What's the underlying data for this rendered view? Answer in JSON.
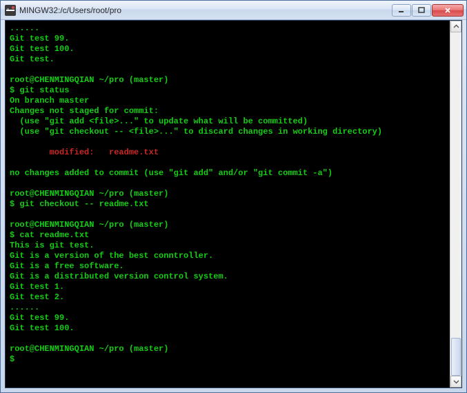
{
  "window": {
    "title": "MINGW32:/c/Users/root/pro"
  },
  "terminal": {
    "lines": [
      {
        "text": "......"
      },
      {
        "text": "Git test 99."
      },
      {
        "text": "Git test 100."
      },
      {
        "text": "Git test."
      },
      {
        "text": ""
      },
      {
        "text": "root@CHENMINGQIAN ~/pro (master)",
        "class": "prompt"
      },
      {
        "text": "$ git status"
      },
      {
        "text": "On branch master"
      },
      {
        "text": "Changes not staged for commit:"
      },
      {
        "text": "  (use \"git add <file>...\" to update what will be committed)"
      },
      {
        "text": "  (use \"git checkout -- <file>...\" to discard changes in working directory)"
      },
      {
        "text": ""
      },
      {
        "text": "        modified:   readme.txt",
        "class": "red"
      },
      {
        "text": ""
      },
      {
        "text": "no changes added to commit (use \"git add\" and/or \"git commit -a\")"
      },
      {
        "text": ""
      },
      {
        "text": "root@CHENMINGQIAN ~/pro (master)",
        "class": "prompt"
      },
      {
        "text": "$ git checkout -- readme.txt"
      },
      {
        "text": ""
      },
      {
        "text": "root@CHENMINGQIAN ~/pro (master)",
        "class": "prompt"
      },
      {
        "text": "$ cat readme.txt"
      },
      {
        "text": "This is git test."
      },
      {
        "text": "Git is a version of the best conntroller."
      },
      {
        "text": "Git is a free software."
      },
      {
        "text": "Git is a distributed version control system."
      },
      {
        "text": "Git test 1."
      },
      {
        "text": "Git test 2."
      },
      {
        "text": "......"
      },
      {
        "text": "Git test 99."
      },
      {
        "text": "Git test 100."
      },
      {
        "text": ""
      },
      {
        "text": "root@CHENMINGQIAN ~/pro (master)",
        "class": "prompt"
      },
      {
        "text": "$"
      }
    ]
  }
}
